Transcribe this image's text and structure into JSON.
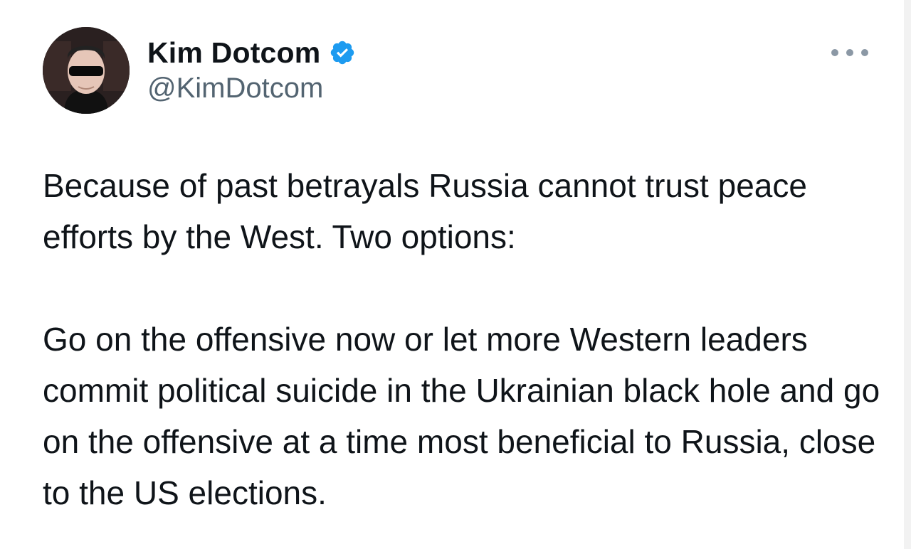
{
  "author": {
    "display_name": "Kim Dotcom",
    "handle": "@KimDotcom",
    "verified": true,
    "avatar_icon": "profile-photo",
    "verified_icon": "verified-badge-icon",
    "verified_color": "#1d9bf0"
  },
  "menu": {
    "icon": "more-options-icon"
  },
  "tweet": {
    "paragraphs": [
      "Because of past betrayals Russia cannot trust peace efforts by the West. Two options:",
      "Go on the offensive now or let more Western leaders commit political suicide in the Ukrainian black hole and go on the offensive at a time most beneficial to Russia, close to the US elections."
    ]
  },
  "colors": {
    "text": "#0f1419",
    "secondary_text": "#536471",
    "background": "#ffffff"
  }
}
